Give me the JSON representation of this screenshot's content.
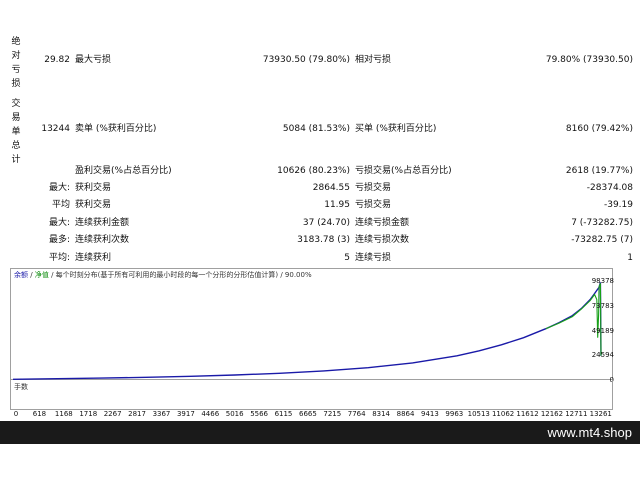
{
  "sections": {
    "drawdown_label": "绝对亏损",
    "trades_label": "交易单总计"
  },
  "rows": [
    {
      "c1": "29.82",
      "c2": "最大亏损",
      "c3": "73930.50 (79.80%)",
      "c4": "相对亏损",
      "c5": "79.80% (73930.50)"
    },
    {
      "c1": "13244",
      "c2": "卖单 (%获利百分比)",
      "c3": "5084 (81.53%)",
      "c4": "买单 (%获利百分比)",
      "c5": "8160 (79.42%)"
    },
    {
      "c1": "",
      "c2": "盈利交易(%占总百分比)",
      "c3": "10626 (80.23%)",
      "c4": "亏损交易(%占总百分比)",
      "c5": "2618 (19.77%)"
    },
    {
      "c1": "最大:",
      "c2": "获利交易",
      "c3": "2864.55",
      "c4": "亏损交易",
      "c5": "-28374.08"
    },
    {
      "c1": "平均",
      "c2": "获利交易",
      "c3": "11.95",
      "c4": "亏损交易",
      "c5": "-39.19"
    },
    {
      "c1": "最大:",
      "c2": "连续获利金额",
      "c3": "37 (24.70)",
      "c4": "连续亏损金额",
      "c5": "7 (-73282.75)"
    },
    {
      "c1": "最多:",
      "c2": "连续获利次数",
      "c3": "3183.78 (3)",
      "c4": "连续亏损次数",
      "c5": "-73282.75 (7)"
    },
    {
      "c1": "平均:",
      "c2": "连续获利",
      "c3": "5",
      "c4": "连续亏损",
      "c5": "1"
    }
  ],
  "chart": {
    "header_balance": "余额",
    "header_equity": "净值",
    "header_rest": "/ 每个时刻分布(基于所有可利用的最小时段的每一个分形的分形估值计算) / 90.00%",
    "volume_label": "手数",
    "y_ticks": [
      "98378",
      "73783",
      "49189",
      "24594",
      "0"
    ],
    "x_ticks": [
      "0",
      "618",
      "1168",
      "1718",
      "2267",
      "2817",
      "3367",
      "3917",
      "4466",
      "5016",
      "5566",
      "6115",
      "6665",
      "7215",
      "7764",
      "8314",
      "8864",
      "9413",
      "9963",
      "10513",
      "11062",
      "11612",
      "12162",
      "12711",
      "13261"
    ],
    "colors": {
      "balance": "#1a1aa8",
      "equity": "#18a018"
    }
  },
  "chart_data": {
    "type": "line",
    "title": "",
    "xlabel": "",
    "ylabel": "",
    "ylim": [
      0,
      98378
    ],
    "xlim": [
      0,
      13244
    ],
    "series": [
      {
        "name": "余额",
        "x": [
          0,
          1000,
          2000,
          3000,
          4000,
          5000,
          6000,
          7000,
          8000,
          9000,
          10000,
          10500,
          11000,
          11500,
          12000,
          12300,
          12600,
          12800,
          13000,
          13100,
          13150,
          13200,
          13230,
          13244
        ],
        "values": [
          700,
          1300,
          1900,
          2700,
          3700,
          5000,
          6700,
          9000,
          12200,
          17000,
          24000,
          29000,
          35000,
          42000,
          51000,
          57000,
          64000,
          71000,
          80000,
          86000,
          89000,
          92000,
          97000,
          24000
        ]
      },
      {
        "name": "净值",
        "x": [
          12000,
          12300,
          12600,
          12800,
          13000,
          13100,
          13150,
          13170,
          13190,
          13200,
          13230,
          13244
        ],
        "values": [
          51000,
          56500,
          63000,
          70500,
          79000,
          85000,
          80000,
          42000,
          65000,
          92000,
          96000,
          24000
        ]
      }
    ]
  },
  "footer": {
    "site": "www.mt4.shop"
  }
}
